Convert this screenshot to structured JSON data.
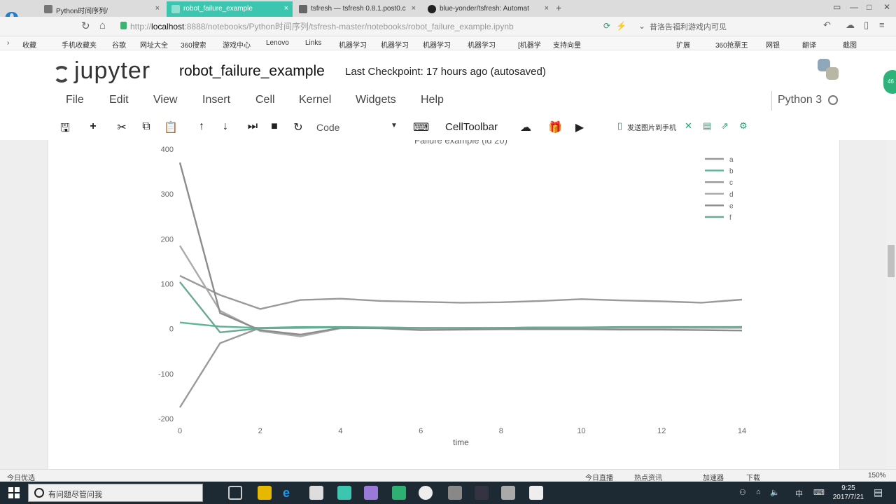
{
  "browser": {
    "tabs": [
      {
        "label": "Python时间序列/",
        "active": false
      },
      {
        "label": "robot_failure_example",
        "active": true
      },
      {
        "label": "tsfresh — tsfresh 0.8.1.post0.c",
        "active": false
      },
      {
        "label": "blue-yonder/tsfresh: Automat",
        "active": false
      }
    ],
    "new_tab": "+",
    "url_prefix": "http://",
    "url_host": "localhost",
    "url_rest": ":8888/notebooks/Python时间序列/tsfresh-master/notebooks/robot_failure_example.ipynb",
    "search_text": "普洛告福利游戏内可见",
    "bookmarks": [
      "收藏",
      "手机收藏夹",
      "谷歌",
      "网址大全",
      "360搜索",
      "游戏中心",
      "Lenovo",
      "Links",
      "机器学习",
      "机器学习",
      "机器学习",
      "机器学习",
      "[机器学",
      "支持向量"
    ],
    "bookmarks_right": [
      "扩展",
      "360抢票王",
      "网银",
      "翻译",
      "截图"
    ]
  },
  "jupyter": {
    "logo_text": "jupyter",
    "notebook_name": "robot_failure_example",
    "checkpoint": "Last Checkpoint: 17 hours ago (autosaved)",
    "menu": [
      "File",
      "Edit",
      "View",
      "Insert",
      "Cell",
      "Kernel",
      "Widgets",
      "Help"
    ],
    "kernel": "Python 3",
    "cell_type": "Code",
    "cell_toolbar": "CellToolbar",
    "ext_send": "发送图片到手机",
    "side_badge": "46"
  },
  "chart_data": {
    "type": "line",
    "title": "Failure example (id 20)",
    "xlabel": "time",
    "ylabel": "",
    "xlim": [
      0,
      14
    ],
    "ylim": [
      -200,
      400
    ],
    "xticks": [
      0,
      2,
      4,
      6,
      8,
      10,
      12,
      14
    ],
    "yticks": [
      400,
      300,
      200,
      100,
      0,
      -100,
      -200
    ],
    "legend_position": "top-right",
    "x": [
      0,
      1,
      2,
      3,
      4,
      5,
      6,
      7,
      8,
      9,
      10,
      11,
      12,
      13,
      14
    ],
    "series": [
      {
        "name": "a",
        "color": "#9a9a9a",
        "values": [
          -175,
          -32,
          2,
          3,
          3,
          2,
          1,
          1,
          2,
          3,
          3,
          3,
          3,
          3,
          3
        ]
      },
      {
        "name": "b",
        "color": "#5fb59a",
        "values": [
          14,
          5,
          2,
          4,
          4,
          3,
          2,
          2,
          2,
          3,
          3,
          3,
          3,
          3,
          4
        ]
      },
      {
        "name": "c",
        "color": "#999999",
        "values": [
          118,
          75,
          44,
          64,
          67,
          62,
          60,
          58,
          59,
          62,
          66,
          63,
          61,
          58,
          65
        ]
      },
      {
        "name": "d",
        "color": "#aaaaaa",
        "values": [
          185,
          40,
          -5,
          -17,
          1,
          2,
          1,
          1,
          1,
          2,
          2,
          2,
          2,
          2,
          2
        ]
      },
      {
        "name": "e",
        "color": "#8c8c8c",
        "values": [
          370,
          35,
          -3,
          -13,
          2,
          1,
          -3,
          -2,
          -1,
          -1,
          -1,
          -2,
          -2,
          -3,
          -4
        ]
      },
      {
        "name": "f",
        "color": "#6aaa94",
        "values": [
          104,
          -8,
          1,
          2,
          3,
          3,
          2,
          2,
          2,
          3,
          3,
          4,
          4,
          4,
          4
        ]
      }
    ]
  },
  "statusbar": {
    "left": "今日优选",
    "items": [
      "今日直播",
      "热点资讯",
      "加速器",
      "下载",
      "150%"
    ]
  },
  "taskbar": {
    "search_placeholder": "有问题尽管问我",
    "time": "9:25",
    "date": "2017/7/21",
    "ime": "中"
  }
}
